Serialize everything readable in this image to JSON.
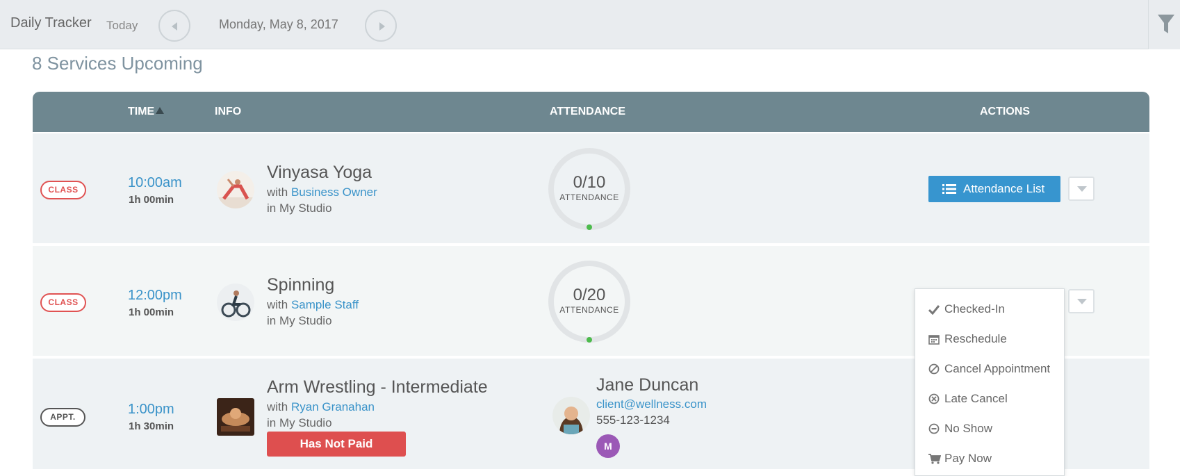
{
  "header": {
    "title": "Daily Tracker",
    "today_label": "Today",
    "date": "Monday, May 8, 2017",
    "prev_icon": "chevron-left-icon",
    "next_icon": "chevron-right-icon",
    "filter_icon": "filter-icon"
  },
  "summary": "8 Services Upcoming",
  "columns": {
    "time": "TIME",
    "info": "INFO",
    "attendance": "ATTENDANCE",
    "actions": "ACTIONS"
  },
  "rows": [
    {
      "badge": "CLASS",
      "time": "10:00am",
      "duration": "1h 00min",
      "name": "Vinyasa Yoga",
      "with_prefix": "with ",
      "staff": "Business Owner",
      "location": "in My Studio",
      "attendance_count": "0/10",
      "attendance_label": "ATTENDANCE",
      "action_label": "Attendance List"
    },
    {
      "badge": "CLASS",
      "time": "12:00pm",
      "duration": "1h 00min",
      "name": "Spinning",
      "with_prefix": "with ",
      "staff": "Sample Staff",
      "location": "in My Studio",
      "attendance_count": "0/20",
      "attendance_label": "ATTENDANCE"
    },
    {
      "badge": "APPT.",
      "time": "1:00pm",
      "duration": "1h 30min",
      "name": "Arm Wrestling - Intermediate",
      "with_prefix": "with ",
      "staff": "Ryan Granahan",
      "location": "in My Studio",
      "payment_status": "Has Not Paid",
      "client": {
        "name": "Jane Duncan",
        "email": "client@wellness.com",
        "phone": "555-123-1234",
        "membership_initial": "M"
      }
    }
  ],
  "menu": {
    "items": [
      {
        "label": "Checked-In",
        "icon": "check-icon"
      },
      {
        "label": "Reschedule",
        "icon": "calendar-icon"
      },
      {
        "label": "Cancel Appointment",
        "icon": "ban-icon"
      },
      {
        "label": "Late Cancel",
        "icon": "times-circle-icon"
      },
      {
        "label": "No Show",
        "icon": "minus-circle-icon"
      },
      {
        "label": "Pay Now",
        "icon": "cart-icon"
      }
    ]
  },
  "colors": {
    "accent": "#3795cf",
    "header_bg": "#6e8790",
    "danger": "#de4f4f",
    "progress": "#4cbb4c",
    "member": "#9b59b6"
  }
}
